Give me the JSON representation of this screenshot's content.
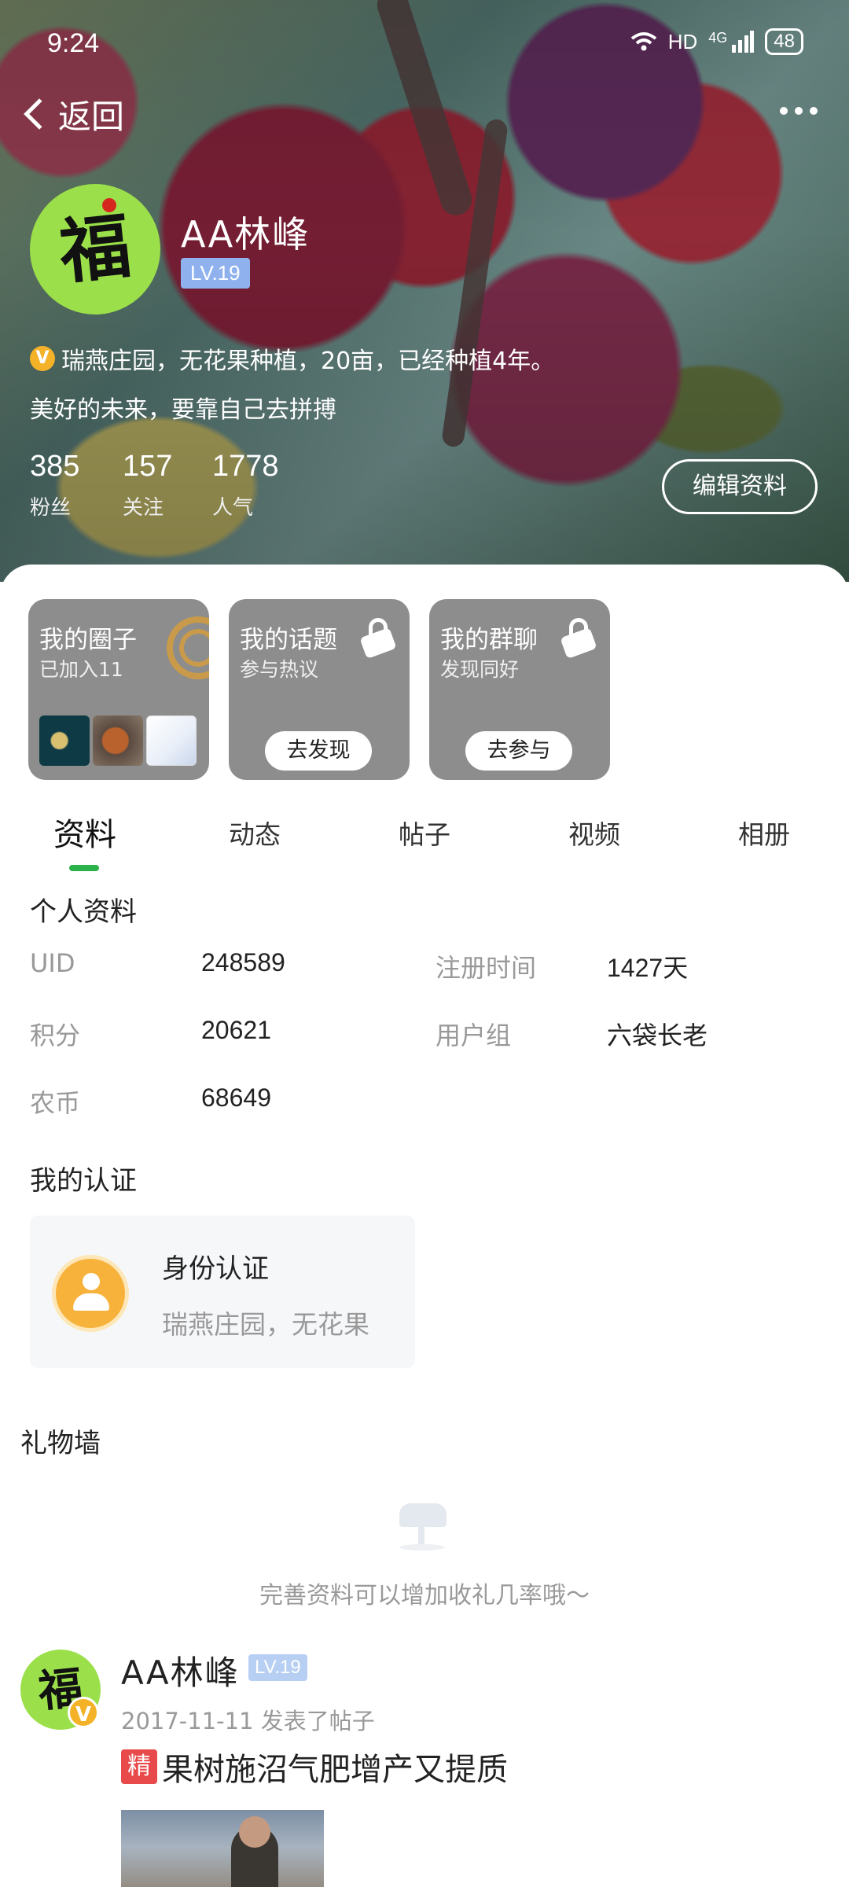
{
  "status": {
    "time": "9:24",
    "hd": "HD",
    "network": "4G",
    "battery": "48"
  },
  "nav": {
    "back_label": "返回"
  },
  "profile": {
    "name": "AA林峰",
    "level": "LV.19",
    "verify_mark": "V",
    "bio_verified": "瑞燕庄园，无花果种植，20亩，已经种植4年。",
    "bio_motto": "美好的未来，要靠自己去拼搏",
    "stats": [
      {
        "num": "385",
        "label": "粉丝"
      },
      {
        "num": "157",
        "label": "关注"
      },
      {
        "num": "1778",
        "label": "人气"
      }
    ],
    "edit_label": "编辑资料"
  },
  "cards": [
    {
      "title": "我的圈子",
      "sub": "已加入11"
    },
    {
      "title": "我的话题",
      "sub": "参与热议",
      "action": "去发现"
    },
    {
      "title": "我的群聊",
      "sub": "发现同好",
      "action": "去参与"
    }
  ],
  "tabs": [
    "资料",
    "动态",
    "帖子",
    "视频",
    "相册"
  ],
  "personal": {
    "title": "个人资料",
    "fields": [
      {
        "label": "UID",
        "value": "248589"
      },
      {
        "label": "注册时间",
        "value": "1427天"
      },
      {
        "label": "积分",
        "value": "20621"
      },
      {
        "label": "用户组",
        "value": "六袋长老"
      },
      {
        "label": "农币",
        "value": "68649"
      }
    ]
  },
  "certification": {
    "title": "我的认证",
    "item_title": "身份认证",
    "item_sub": "瑞燕庄园，无花果"
  },
  "gift_wall": {
    "title": "礼物墙",
    "empty_text": "完善资料可以增加收礼几率哦～"
  },
  "post": {
    "author": "AA林峰",
    "level": "LV.19",
    "meta": "2017-11-11 发表了帖子",
    "badge": "精",
    "title": "果树施沼气肥增产又提质"
  },
  "colors": {
    "accent": "#2bb24a",
    "level_badge": "#8fb2ee",
    "verify": "#f4b228",
    "card_bg": "#8d8d8d",
    "jing": "#e8494a"
  },
  "icons": [
    "back-chevron-icon",
    "more-icon",
    "lock-icon",
    "verified-icon",
    "user-icon",
    "mailbox-icon",
    "wifi-icon",
    "signal-icon",
    "battery-icon"
  ]
}
